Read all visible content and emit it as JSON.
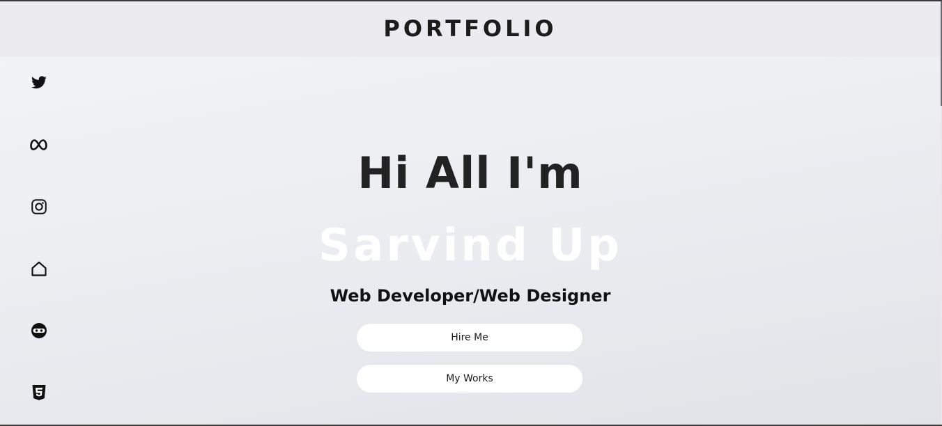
{
  "header": {
    "brand": "PORTFOLIO"
  },
  "social": {
    "items": [
      {
        "icon": "twitter-icon"
      },
      {
        "icon": "meta-icon"
      },
      {
        "icon": "instagram-icon"
      },
      {
        "icon": "home-icon"
      },
      {
        "icon": "ninja-icon"
      },
      {
        "icon": "html5-icon"
      }
    ]
  },
  "hero": {
    "greeting": "Hi All I'm",
    "name": "Sarvind Up",
    "role": "Web Developer/Web Designer"
  },
  "buttons": {
    "hire_label": "Hire Me",
    "works_label": "My Works"
  },
  "colors": {
    "background": "#eceef2",
    "header_bg": "#ececf0",
    "text_dark": "#222222",
    "name_text": "#ffffff",
    "button_bg": "#ffffff"
  }
}
